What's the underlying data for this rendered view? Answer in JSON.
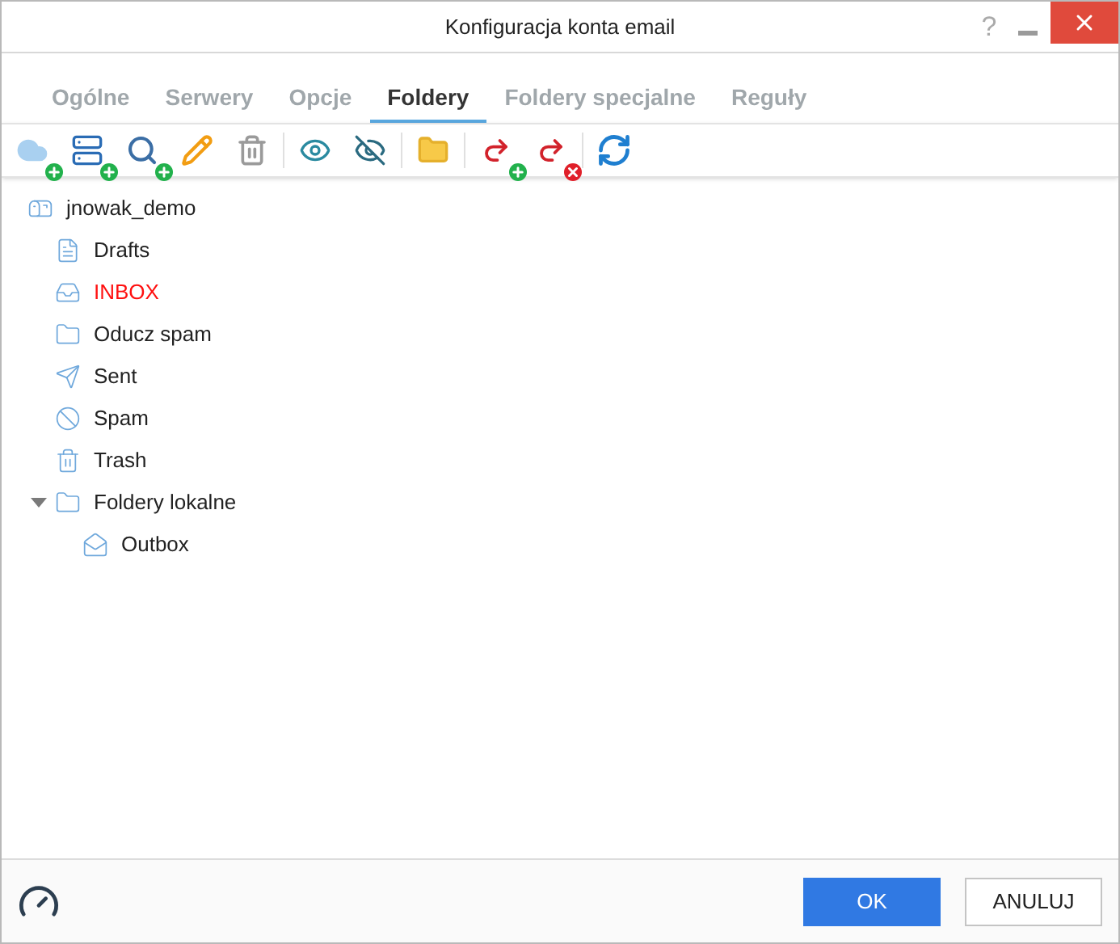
{
  "window": {
    "title": "Konfiguracja konta email",
    "help": "?"
  },
  "tabs": [
    {
      "label": "Ogólne",
      "selected": false
    },
    {
      "label": "Serwery",
      "selected": false
    },
    {
      "label": "Opcje",
      "selected": false
    },
    {
      "label": "Foldery",
      "selected": true
    },
    {
      "label": "Foldery specjalne",
      "selected": false
    },
    {
      "label": "Reguły",
      "selected": false
    }
  ],
  "tree": [
    {
      "label": "jnowak_demo",
      "kind": "account",
      "highlighted": false,
      "children": [
        {
          "label": "Drafts",
          "kind": "drafts",
          "highlighted": false
        },
        {
          "label": "INBOX",
          "kind": "inbox",
          "highlighted": true
        },
        {
          "label": "Oducz spam",
          "kind": "folder",
          "highlighted": false
        },
        {
          "label": "Sent",
          "kind": "sent",
          "highlighted": false
        },
        {
          "label": "Spam",
          "kind": "spam",
          "highlighted": false
        },
        {
          "label": "Trash",
          "kind": "trash",
          "highlighted": false
        },
        {
          "label": "Foldery lokalne",
          "kind": "folder",
          "highlighted": false,
          "expanded": true,
          "children": [
            {
              "label": "Outbox",
              "kind": "outbox",
              "highlighted": false
            }
          ]
        }
      ]
    }
  ],
  "buttons": [
    {
      "label": "OK",
      "kind": "primary"
    },
    {
      "label": "ANULUJ",
      "kind": "secondary"
    }
  ]
}
